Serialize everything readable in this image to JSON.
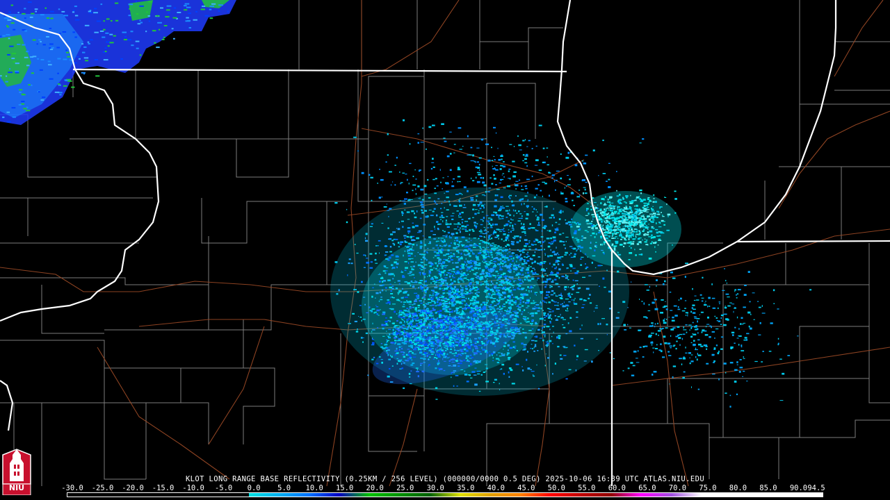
{
  "map": {
    "caption": "KLOT LONG RANGE BASE REFLECTIVITY (0.25KM / 256 LEVEL) (000000/0000 0.5 DEG) 2025-10-06 16:39 UTC  ATLAS.NIU.EDU",
    "radar_site": "KLOT",
    "product": "Long Range Base Reflectivity",
    "timestamp": "2025-10-06 16:39 UTC",
    "source": "ATLAS.NIU.EDU",
    "background_color": "#000000",
    "state_border_color": "#ffffff",
    "county_line_color": "#888888",
    "highway_color": "#a0522d"
  },
  "scale": {
    "labels": [
      "-30.0",
      "-25.0",
      "-20.0",
      "-15.0",
      "-10.0",
      "-5.0",
      "0.0",
      "5.0",
      "10.0",
      "15.0",
      "20.0",
      "25.0",
      "30.0",
      "35.0",
      "40.0",
      "45.0",
      "50.0",
      "55.0",
      "60.0",
      "65.0",
      "70.0",
      "75.0",
      "80.0",
      "85.0",
      "90.0",
      "94.5"
    ],
    "colors": [
      "#000000",
      "#000000",
      "#000000",
      "#000000",
      "#000000",
      "#000000",
      "#00e0e0",
      "#00b0f0",
      "#0070ff",
      "#0000c0",
      "#00c000",
      "#009000",
      "#006000",
      "#e0e000",
      "#e0a000",
      "#ff8000",
      "#ff0000",
      "#c00000",
      "#900000",
      "#ff00ff",
      "#a050e0",
      "#ffffff",
      "#ffffff",
      "#ffffff",
      "#ffffff"
    ]
  },
  "logo": {
    "text": "NIU",
    "icon": "niu-tower-icon"
  }
}
